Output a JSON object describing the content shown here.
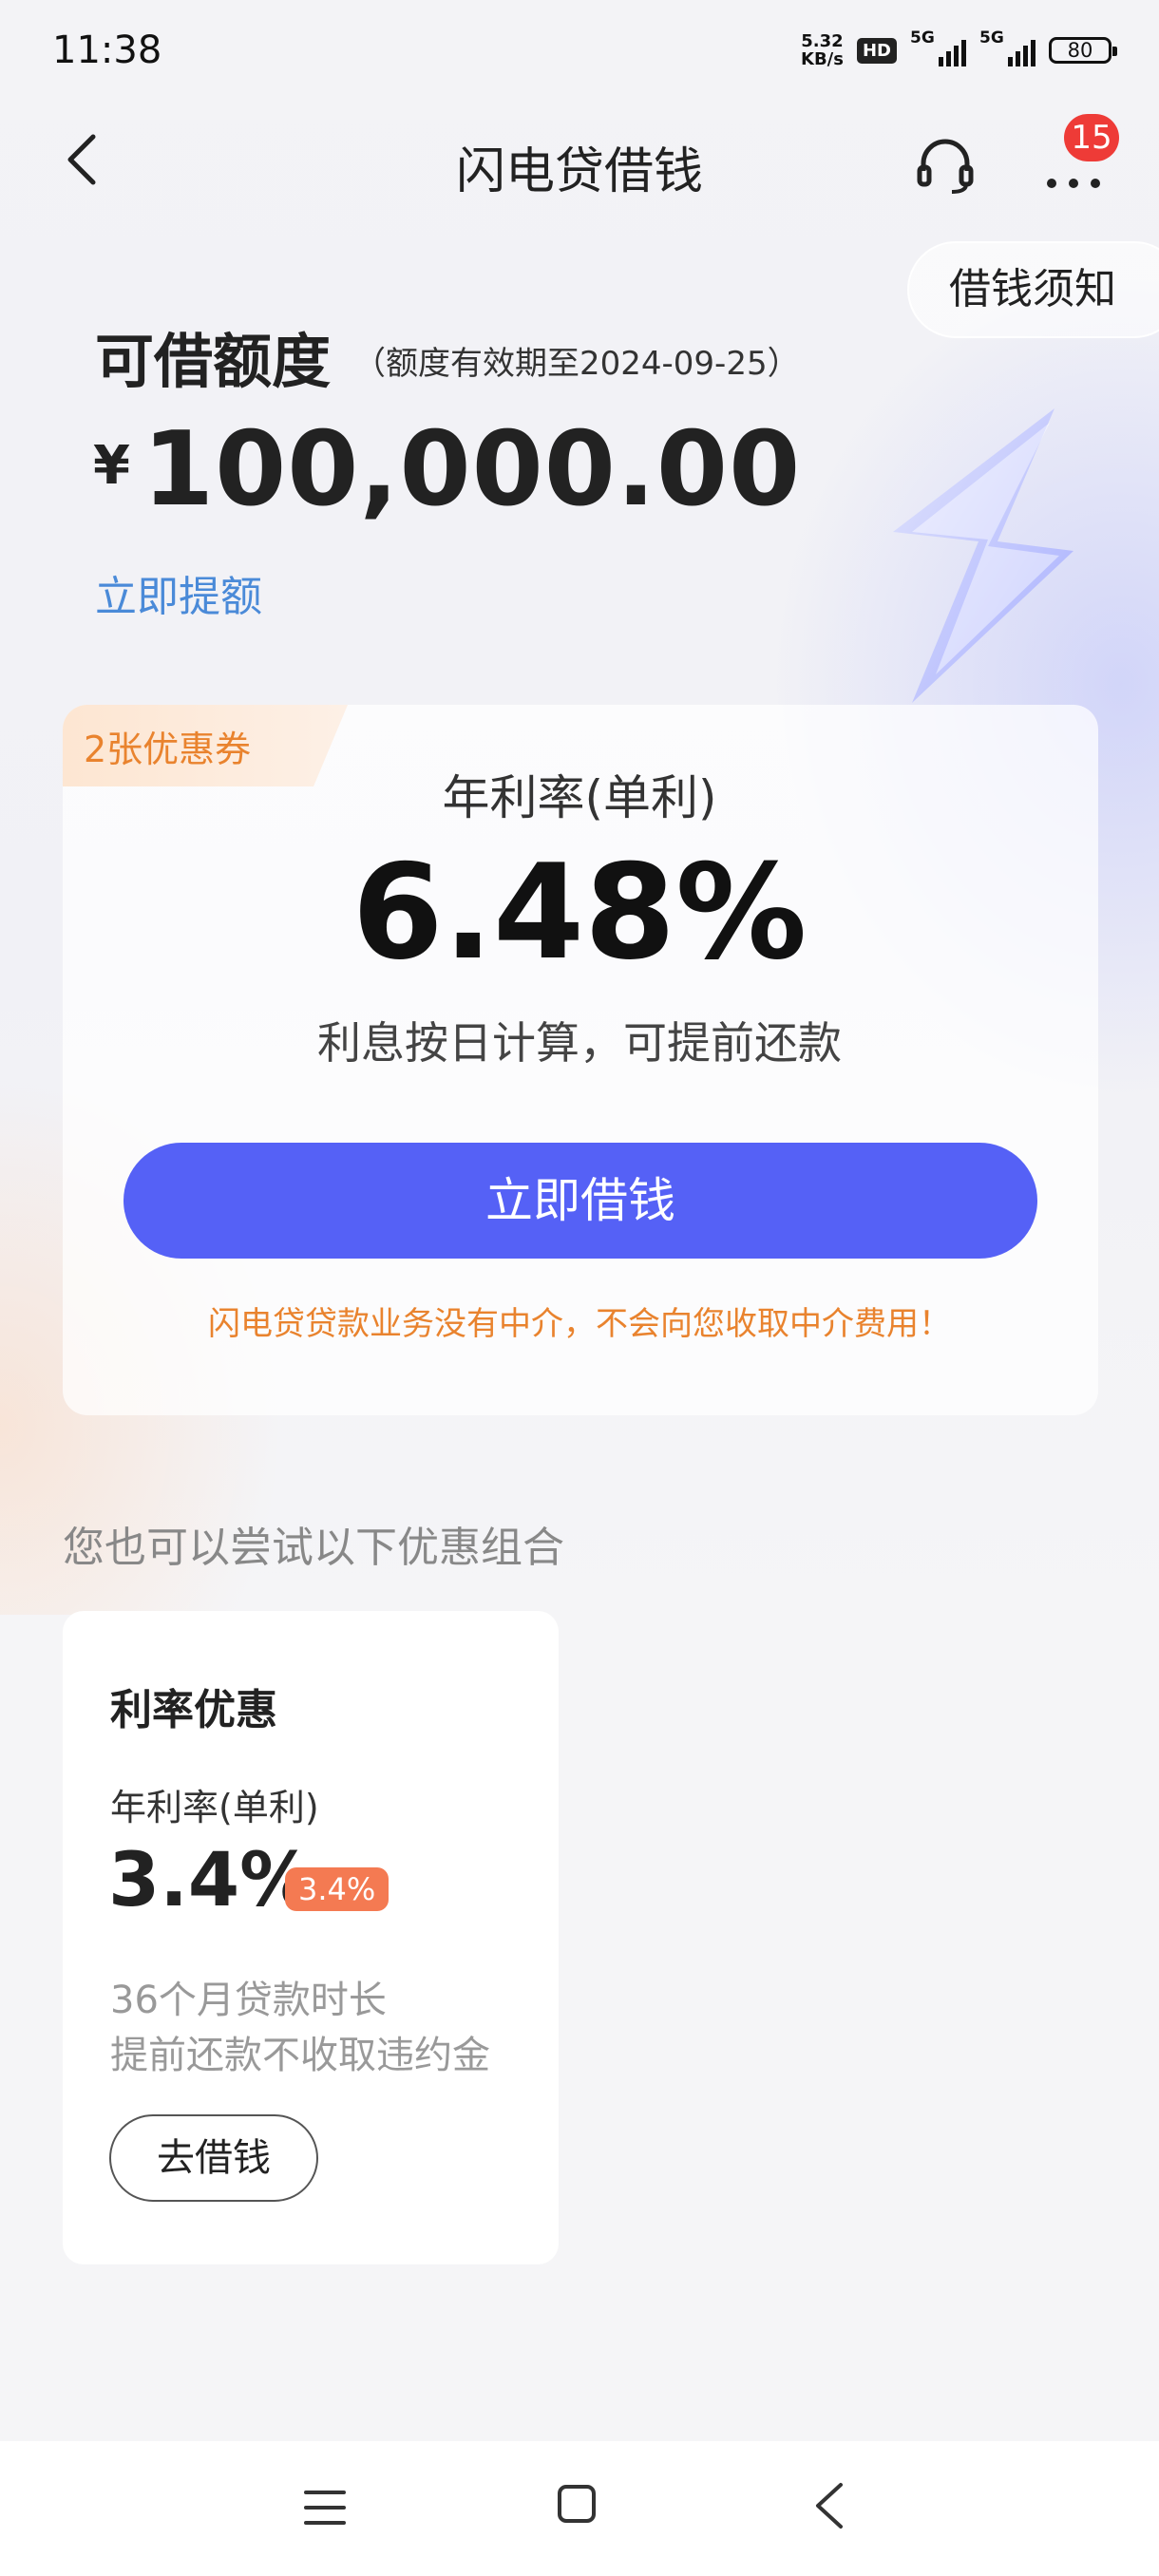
{
  "status_bar": {
    "time": "11:38",
    "net_speed_value": "5.32",
    "net_speed_unit": "KB/s",
    "hd_label": "HD",
    "sim1_label": "5G",
    "sim2_label": "5G",
    "battery": "80"
  },
  "nav": {
    "title": "闪电贷借钱",
    "message_badge": "15"
  },
  "notice_button": "借钱须知",
  "quota": {
    "title": "可借额度",
    "validity": "（额度有效期至2024-09-25）",
    "currency": "¥",
    "amount": "100,000.00",
    "raise_link": "立即提额"
  },
  "main_card": {
    "coupon": "2张优惠券",
    "rate_label": "年利率(单利)",
    "rate_value": "6.48%",
    "rate_note": "利息按日计算，可提前还款",
    "borrow_button": "立即借钱",
    "warning": "闪电贷贷款业务没有中介，不会向您收取中介费用！"
  },
  "combo_section": {
    "title": "您也可以尝试以下优惠组合",
    "offer": {
      "title": "利率优惠",
      "rate_label": "年利率(单利)",
      "rate_value": "3.4%",
      "rate_tag": "3.4%",
      "desc_1": "36个月贷款时长",
      "desc_2": "提前还款不收取违约金",
      "button": "去借钱"
    }
  },
  "colors": {
    "primary": "#5561f6",
    "warning": "#e9832e",
    "link": "#4a8ad8",
    "badge": "#ee3b37",
    "tag": "#f47a52"
  },
  "icons": {
    "back": "chevron-left-icon",
    "service": "headset-icon",
    "more": "more-dots-icon",
    "decor": "lightning-bolt-icon",
    "sys_menu": "menu-lines-icon",
    "sys_home": "square-home-icon",
    "sys_back": "triangle-back-icon"
  }
}
